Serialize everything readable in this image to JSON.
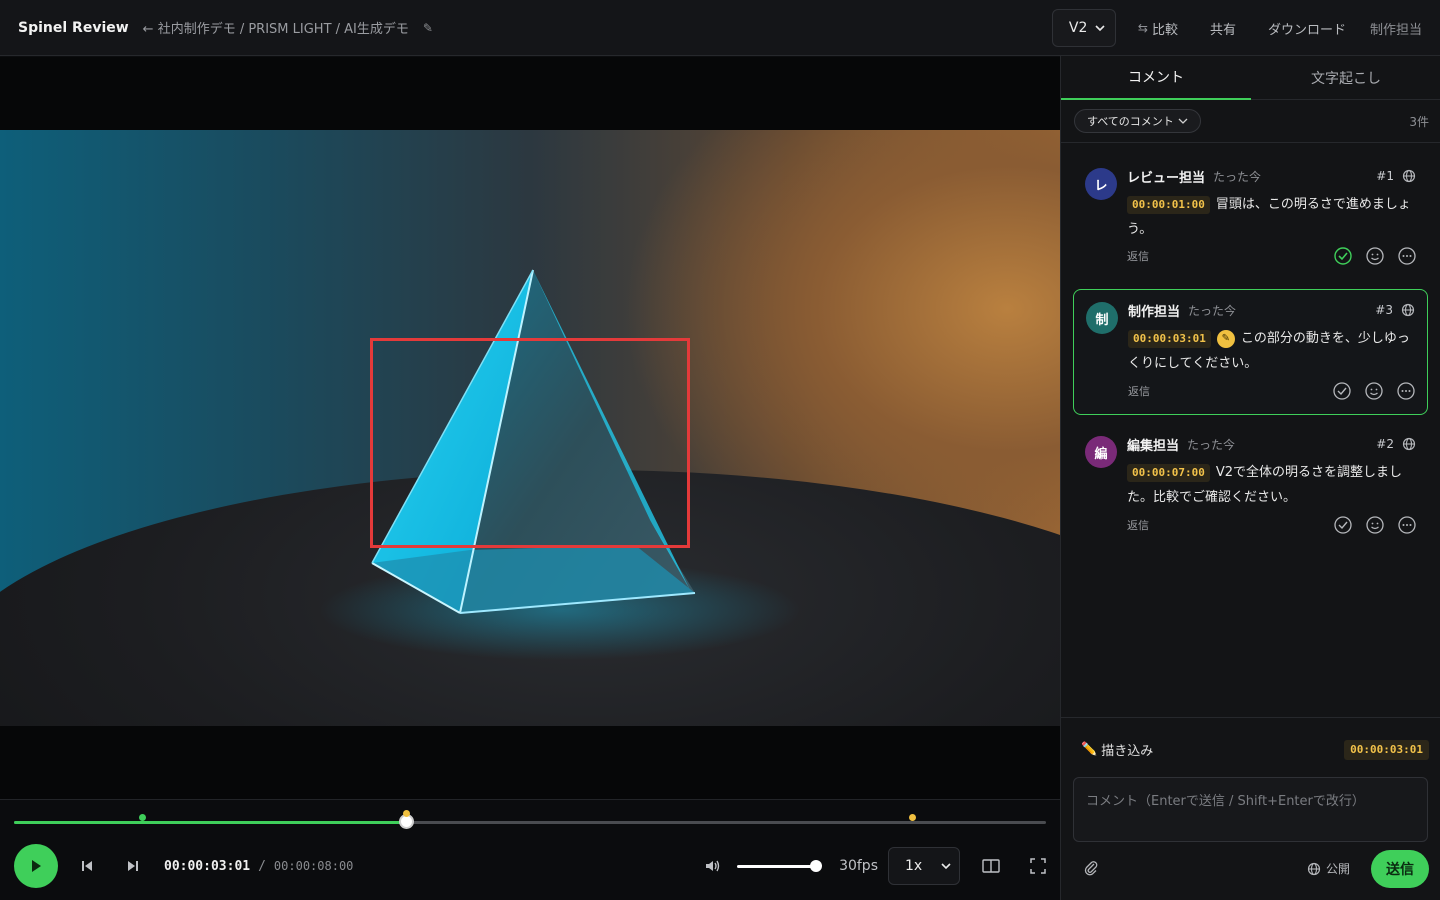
{
  "header": {
    "brand": "Spinel Review",
    "breadcrumb": "← 社内制作デモ / PRISM LIGHT / AI生成デモ",
    "version": "V2",
    "compare_label": "比較",
    "share_label": "共有",
    "download_label": "ダウンロード",
    "user_label": "制作担当"
  },
  "player": {
    "current_time": "00:00:03:01",
    "total_time": "00:00:08:00",
    "fps": "30fps",
    "speed": "1x",
    "progress": 0.38,
    "markers": [
      {
        "position": 0.124,
        "color": "#3fcf5a"
      },
      {
        "position": 0.38,
        "color": "#f0c040"
      },
      {
        "position": 0.87,
        "color": "#f0c040"
      }
    ],
    "volume": 1.0
  },
  "sidebar": {
    "tabs": [
      {
        "label": "コメント",
        "active": true
      },
      {
        "label": "文字起こし",
        "active": false
      }
    ],
    "filter_label": "すべてのコメント",
    "count_label": "3件",
    "comments": [
      {
        "initial": "レ",
        "avatar_color": "#2c3a8a",
        "author": "レビュー担当",
        "time": "たった今",
        "number": "#1",
        "timecode": "00:00:01:00",
        "text": "冒頭は、この明るさで進めましょう。",
        "reply": "返信",
        "resolved": true
      },
      {
        "initial": "制",
        "avatar_color": "#1f6e6a",
        "author": "制作担当",
        "time": "たった今",
        "number": "#3",
        "timecode": "00:00:03:01",
        "text": "この部分の動きを、少しゆっくりにしてください。",
        "reply": "返信",
        "resolved": false
      },
      {
        "initial": "編",
        "avatar_color": "#7a2a78",
        "author": "編集担当",
        "time": "たった今",
        "number": "#2",
        "timecode": "00:00:07:00",
        "text": "V2で全体の明るさを調整しました。比較でご確認ください。",
        "reply": "返信",
        "resolved": false
      }
    ],
    "composer": {
      "draw_label": "描き込み",
      "timecode": "00:00:03:01",
      "placeholder": "コメント（Enterで送信 / Shift+Enterで改行）",
      "visibility_label": "公開",
      "send_label": "送信"
    }
  },
  "colors": {
    "accent": "#3fcf5a",
    "timecode": "#f2c24a",
    "annotation": "#e43a3a"
  }
}
